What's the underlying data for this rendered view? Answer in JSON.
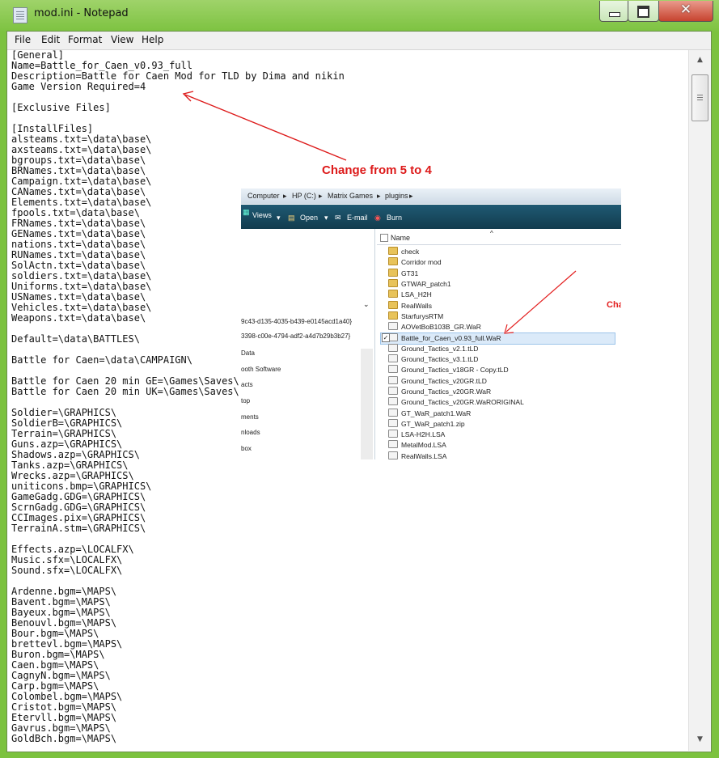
{
  "window": {
    "title": "mod.ini - Notepad",
    "close_glyph": "✕"
  },
  "menu": [
    "File",
    "Edit",
    "Format",
    "View",
    "Help"
  ],
  "editor": {
    "text": "[General]\nName=Battle_for_Caen_v0.93_full\nDescription=Battle for Caen Mod for TLD by Dima and nikin\nGame Version Required=4\n\n[Exclusive Files]\n\n[InstallFiles]\nalsteams.txt=\\data\\base\\\naxsteams.txt=\\data\\base\\\nbgroups.txt=\\data\\base\\\nBRNames.txt=\\data\\base\\\nCampaign.txt=\\data\\base\\\nCANames.txt=\\data\\base\\\nElements.txt=\\data\\base\\\nfpools.txt=\\data\\base\\\nFRNames.txt=\\data\\base\\\nGENames.txt=\\data\\base\\\nnations.txt=\\data\\base\\\nRUNames.txt=\\data\\base\\\nSolActn.txt=\\data\\base\\\nsoldiers.txt=\\data\\base\\\nUniforms.txt=\\data\\base\\\nUSNames.txt=\\data\\base\\\nVehicles.txt=\\data\\base\\\nWeapons.txt=\\data\\base\\\n\nDefault=\\data\\BATTLES\\\n\nBattle for Caen=\\data\\CAMPAIGN\\\n\nBattle for Caen 20 min GE=\\Games\\Saves\\\nBattle for Caen 20 min UK=\\Games\\Saves\\\n\nSoldier=\\GRAPHICS\\\nSoldierB=\\GRAPHICS\\\nTerrain=\\GRAPHICS\\\nGuns.azp=\\GRAPHICS\\\nShadows.azp=\\GRAPHICS\\\nTanks.azp=\\GRAPHICS\\\nWrecks.azp=\\GRAPHICS\\\nuniticons.bmp=\\GRAPHICS\\\nGameGadg.GDG=\\GRAPHICS\\\nScrnGadg.GDG=\\GRAPHICS\\\nCCImages.pix=\\GRAPHICS\\\nTerrainA.stm=\\GRAPHICS\\\n\nEffects.azp=\\LOCALFX\\\nMusic.sfx=\\LOCALFX\\\nSound.sfx=\\LOCALFX\\\n\nArdenne.bgm=\\MAPS\\\nBavent.bgm=\\MAPS\\\nBayeux.bgm=\\MAPS\\\nBenouvl.bgm=\\MAPS\\\nBour.bgm=\\MAPS\\\nbrettevl.bgm=\\MAPS\\\nBuron.bgm=\\MAPS\\\nCaen.bgm=\\MAPS\\\nCagnyN.bgm=\\MAPS\\\nCarp.bgm=\\MAPS\\\nColombel.bgm=\\MAPS\\\nCristot.bgm=\\MAPS\\\nEtervll.bgm=\\MAPS\\\nGavrus.bgm=\\MAPS\\\nGoldBch.bgm=\\MAPS\\"
  },
  "annotation_main": "Change from 5 to 4",
  "explorer": {
    "breadcrumb": [
      "Computer",
      "HP (C:)",
      "Matrix Games",
      "plugins"
    ],
    "toolbar": [
      "Views",
      "Open",
      "E-mail",
      "Burn"
    ],
    "left_rows": [
      "9c43-d135-4035-b439-e0145acd1a40}",
      "3398-c00e-4794-adf2-a4d7b29b3b27}",
      "Data",
      "ooth Software",
      "acts",
      "top",
      "ments",
      "nloads",
      "box"
    ],
    "column_header": "Name",
    "files": [
      {
        "name": "check",
        "kind": "folder"
      },
      {
        "name": "Corridor mod",
        "kind": "folder"
      },
      {
        "name": "GT31",
        "kind": "folder"
      },
      {
        "name": "GTWAR_patch1",
        "kind": "folder"
      },
      {
        "name": "LSA_H2H",
        "kind": "folder"
      },
      {
        "name": "RealWalls",
        "kind": "folder"
      },
      {
        "name": "StarfurysRTM",
        "kind": "folder"
      },
      {
        "name": "AOVetBoB103B_GR.WaR",
        "kind": "file"
      },
      {
        "name": "Battle_for_Caen_v0.93_full.WaR",
        "kind": "file",
        "selected": true
      },
      {
        "name": "Ground_Tactics_v2.1.tLD",
        "kind": "file"
      },
      {
        "name": "Ground_Tactics_v3.1.tLD",
        "kind": "file"
      },
      {
        "name": "Ground_Tactics_v18GR - Copy.tLD",
        "kind": "file"
      },
      {
        "name": "Ground_Tactics_v20GR.tLD",
        "kind": "file"
      },
      {
        "name": "Ground_Tactics_v20GR.WaR",
        "kind": "file"
      },
      {
        "name": "Ground_Tactics_v20GR.WaRORIGINAL",
        "kind": "file"
      },
      {
        "name": "GT_WaR_patch1.WaR",
        "kind": "file"
      },
      {
        "name": "GT_WaR_patch1.zip",
        "kind": "file"
      },
      {
        "name": "LSA-H2H.LSA",
        "kind": "file"
      },
      {
        "name": "MetalMod.LSA",
        "kind": "file"
      },
      {
        "name": "RealWalls.LSA",
        "kind": "file"
      }
    ],
    "annotation": "Change tLD extension to WaR"
  },
  "colors": {
    "annotation_red": "#dd1a1a",
    "window_frame_green": "#7cc23f"
  }
}
